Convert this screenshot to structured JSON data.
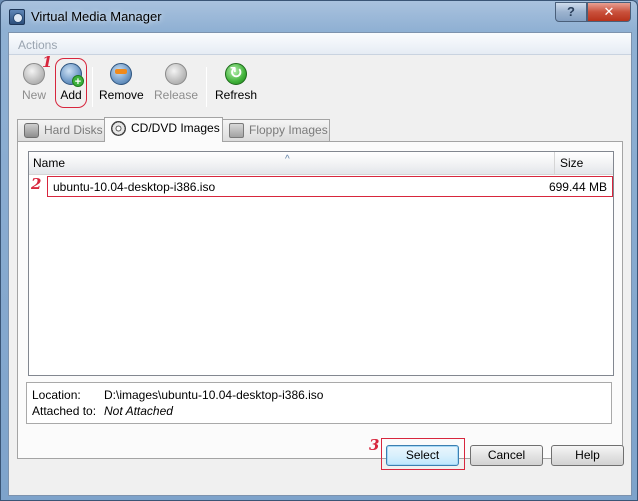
{
  "window": {
    "title": "Virtual Media Manager",
    "help_glyph": "?",
    "close_glyph": "✕"
  },
  "actions": {
    "label": "Actions",
    "items": [
      {
        "label": "New",
        "enabled": false
      },
      {
        "label": "Add",
        "enabled": true
      },
      {
        "label": "Remove",
        "enabled": true
      },
      {
        "label": "Release",
        "enabled": false
      },
      {
        "label": "Refresh",
        "enabled": true
      }
    ]
  },
  "tabs": [
    {
      "label": "Hard Disks",
      "active": false
    },
    {
      "label": "CD/DVD Images",
      "active": true
    },
    {
      "label": "Floppy Images",
      "active": false
    }
  ],
  "list": {
    "columns": [
      "Name",
      "Size"
    ],
    "sort_glyph": "^",
    "rows": [
      {
        "name": "ubuntu-10.04-desktop-i386.iso",
        "size": "699.44 MB"
      }
    ]
  },
  "details": {
    "location_label": "Location:",
    "location_value": "D:\\images\\ubuntu-10.04-desktop-i386.iso",
    "attached_label": "Attached to:",
    "attached_value": "Not Attached"
  },
  "buttons": {
    "select": "Select",
    "cancel": "Cancel",
    "help": "Help"
  },
  "annotations": {
    "one": "1",
    "two": "2",
    "three": "3",
    "color": "#d7263d"
  }
}
